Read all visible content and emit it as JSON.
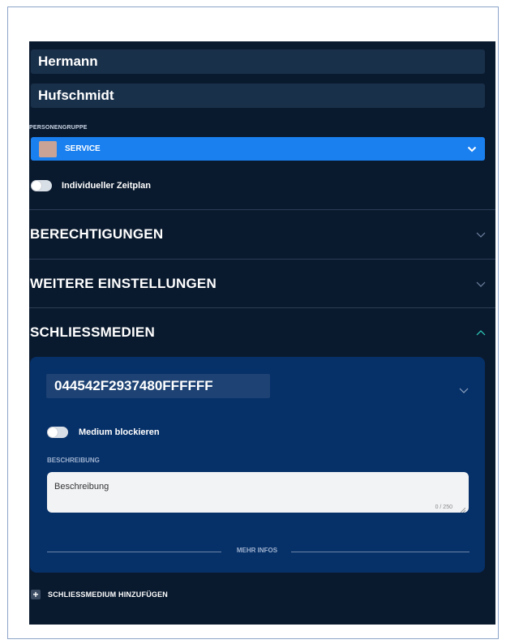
{
  "person": {
    "first_name": "Hermann",
    "last_name": "Hufschmidt"
  },
  "group": {
    "label": "PERSONENGRUPPE",
    "selected": "SERVICE",
    "swatch_color": "#c9a396",
    "select_color": "#1a80f0"
  },
  "schedule_toggle": {
    "label": "Individueller Zeitplan",
    "on": false
  },
  "sections": {
    "permissions": "BERECHTIGUNGEN",
    "more_settings": "WEITERE EINSTELLUNGEN",
    "media": "SCHLIESSMEDIEN"
  },
  "medium": {
    "id": "044542F2937480FFFFFF",
    "block_label": "Medium blockieren",
    "block_on": false,
    "description_label": "BESCHREIBUNG",
    "description_placeholder": "Beschreibung",
    "counter": "0 / 250",
    "more_info": "MEHR INFOS"
  },
  "add_medium": {
    "icon": "plus-icon",
    "label": "SCHLIESSMEDIUM HINZUFÜGEN"
  },
  "colors": {
    "panel_bg": "#0a1a2e",
    "card_bg": "#063068",
    "accent": "#1a80f0",
    "chevron_up": "#2fd3c0"
  }
}
